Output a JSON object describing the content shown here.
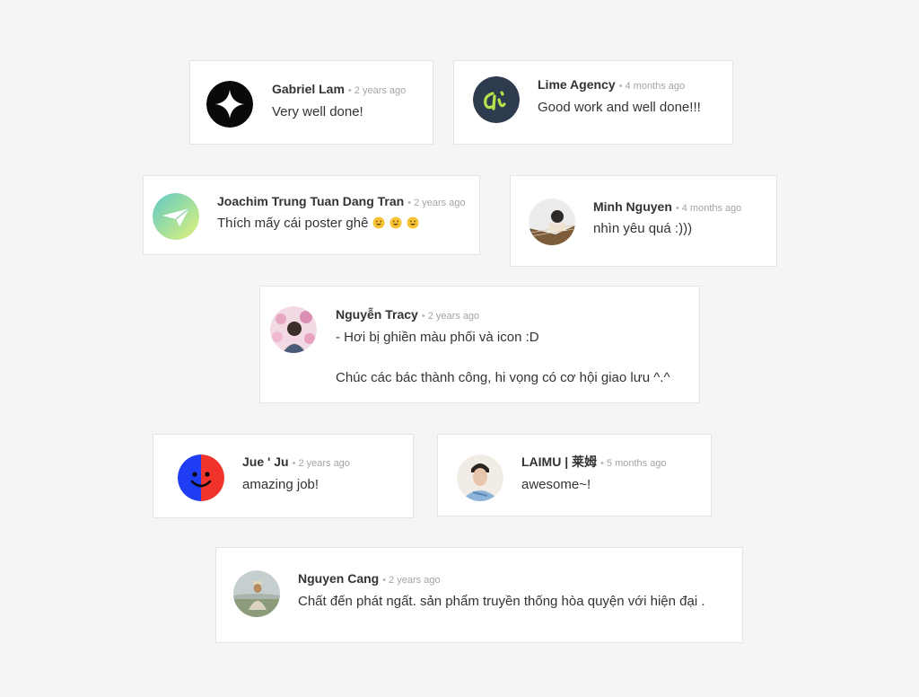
{
  "comments": [
    {
      "name": "Gabriel Lam",
      "separator": "•",
      "time": "2 years ago",
      "text": "Very well done!",
      "avatar_icon": "four-point-star-icon",
      "avatar_color": "#0a0a0a"
    },
    {
      "name": "Lime Agency",
      "separator": "•",
      "time": "4 months ago",
      "text": "Good work and well done!!!",
      "avatar_icon": "lime-di-logo-icon",
      "avatar_color": "#2e3b4e",
      "accent": "#b6e24c"
    },
    {
      "name": "Joachim Trung Tuan Dang Tran",
      "separator": "•",
      "time": "2 years ago",
      "text": "Thích mấy cái poster ghê",
      "emoji_icon": "grinning-face-emoji-icon",
      "emoji_count": 3,
      "avatar_icon": "paper-plane-icon"
    },
    {
      "name": "Minh Nguyen",
      "separator": "•",
      "time": "4 months ago",
      "text": "nhìn yêu quá :)))",
      "avatar_icon": "person-with-guitar-photo"
    },
    {
      "name": "Nguyễn Tracy",
      "separator": "•",
      "time": "2 years ago",
      "text_lines": [
        "- Hơi bị ghiền màu phối và icon :D",
        "Chúc các bác thành công, hi vọng có cơ hội giao lưu ^.^"
      ],
      "avatar_icon": "person-with-flowers-photo"
    },
    {
      "name": "Jue ' Ju",
      "separator": "•",
      "time": "2 years ago",
      "text": "amazing job!",
      "avatar_icon": "blue-red-smile-icon",
      "avatar_colors": [
        "#1f3df2",
        "#f0342b"
      ]
    },
    {
      "name": "LAIMU | 莱姆",
      "separator": "•",
      "time": "5 months ago",
      "text": "awesome~!",
      "avatar_icon": "man-portrait-photo"
    },
    {
      "name": "Nguyen Cang",
      "separator": "•",
      "time": "2 years ago",
      "text": "Chất đến phát ngất. sản phẩm truyền thống hòa quyện với hiện đại .",
      "avatar_icon": "person-outdoors-photo"
    }
  ]
}
